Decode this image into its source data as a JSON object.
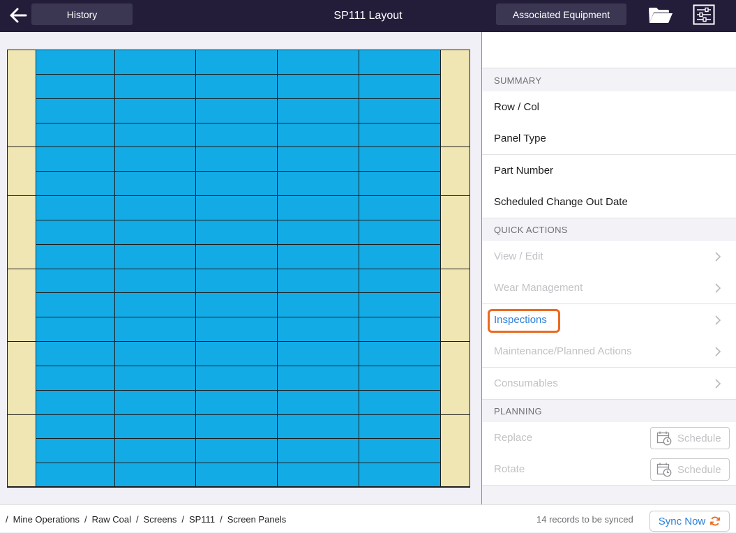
{
  "header": {
    "back_icon": "arrow-left-icon",
    "history_label": "History",
    "title": "SP111 Layout",
    "associated_label": "Associated Equipment",
    "folder_icon": "folder-open-icon",
    "filter_icon": "sliders-icon"
  },
  "layout": {
    "panel_rows": 18,
    "panel_cols": 5,
    "colors": {
      "panel": "#12abe5",
      "side": "#f0e6b3",
      "border": "#1e1e1e"
    }
  },
  "details": {
    "summary_header": "SUMMARY",
    "summary_rows": [
      "Row / Col",
      "Panel Type",
      "Part Number",
      "Scheduled Change Out Date"
    ],
    "quick_actions_header": "QUICK ACTIONS",
    "quick_actions": [
      {
        "label": "View / Edit",
        "enabled": false
      },
      {
        "label": "Wear Management",
        "enabled": false
      },
      {
        "label": "Inspections",
        "enabled": true
      },
      {
        "label": "Maintenance/Planned Actions",
        "enabled": false
      },
      {
        "label": "Consumables",
        "enabled": false
      }
    ],
    "planning_header": "PLANNING",
    "planning": [
      {
        "label": "Replace",
        "button": "Schedule"
      },
      {
        "label": "Rotate",
        "button": "Schedule"
      }
    ],
    "accent": "#2b7fd8",
    "highlight_color": "#ec6a20"
  },
  "footer": {
    "breadcrumbs": [
      "Mine Operations",
      "Raw Coal",
      "Screens",
      "SP111",
      "Screen Panels"
    ],
    "sync_status": "14 records to be synced",
    "sync_button": "Sync Now"
  }
}
